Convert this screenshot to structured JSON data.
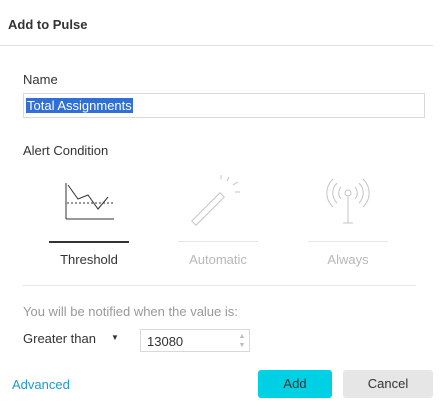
{
  "dialog": {
    "title": "Add to Pulse"
  },
  "name_field": {
    "label": "Name",
    "value": "Total Assignments"
  },
  "alert_condition": {
    "label": "Alert Condition",
    "options": [
      {
        "label": "Threshold",
        "icon": "threshold-chart-icon",
        "selected": true
      },
      {
        "label": "Automatic",
        "icon": "magic-wand-icon",
        "selected": false
      },
      {
        "label": "Always",
        "icon": "broadcast-antenna-icon",
        "selected": false
      }
    ]
  },
  "notification": {
    "text": "You will be notified when the value is:",
    "operator": "Greater than",
    "value": "13080"
  },
  "footer": {
    "advanced_label": "Advanced",
    "add_label": "Add",
    "cancel_label": "Cancel"
  },
  "colors": {
    "accent": "#00d0e4",
    "link": "#1a9bd7",
    "selection": "#2f6fd6"
  }
}
